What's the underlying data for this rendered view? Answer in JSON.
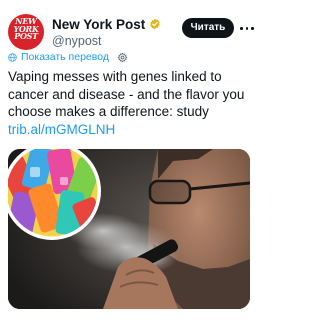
{
  "account": {
    "avatar_text": "NEW\nYORK\nPOST",
    "display_name": "New York Post",
    "handle": "@nypost",
    "verified": true
  },
  "actions": {
    "follow_label": "Читать",
    "more_icon": "more-dots-icon"
  },
  "translate": {
    "label": "Показать перевод",
    "icon": "globe-icon",
    "settings_icon": "gear-icon"
  },
  "tweet": {
    "text": "Vaping messes with genes linked to cancer and disease - and the flavor you choose makes a difference: study ",
    "link": "trib.al/mGMGLNH"
  },
  "colors": {
    "link": "#1d9bf0",
    "brand": "#d8232a",
    "button_bg": "#0f1419"
  }
}
